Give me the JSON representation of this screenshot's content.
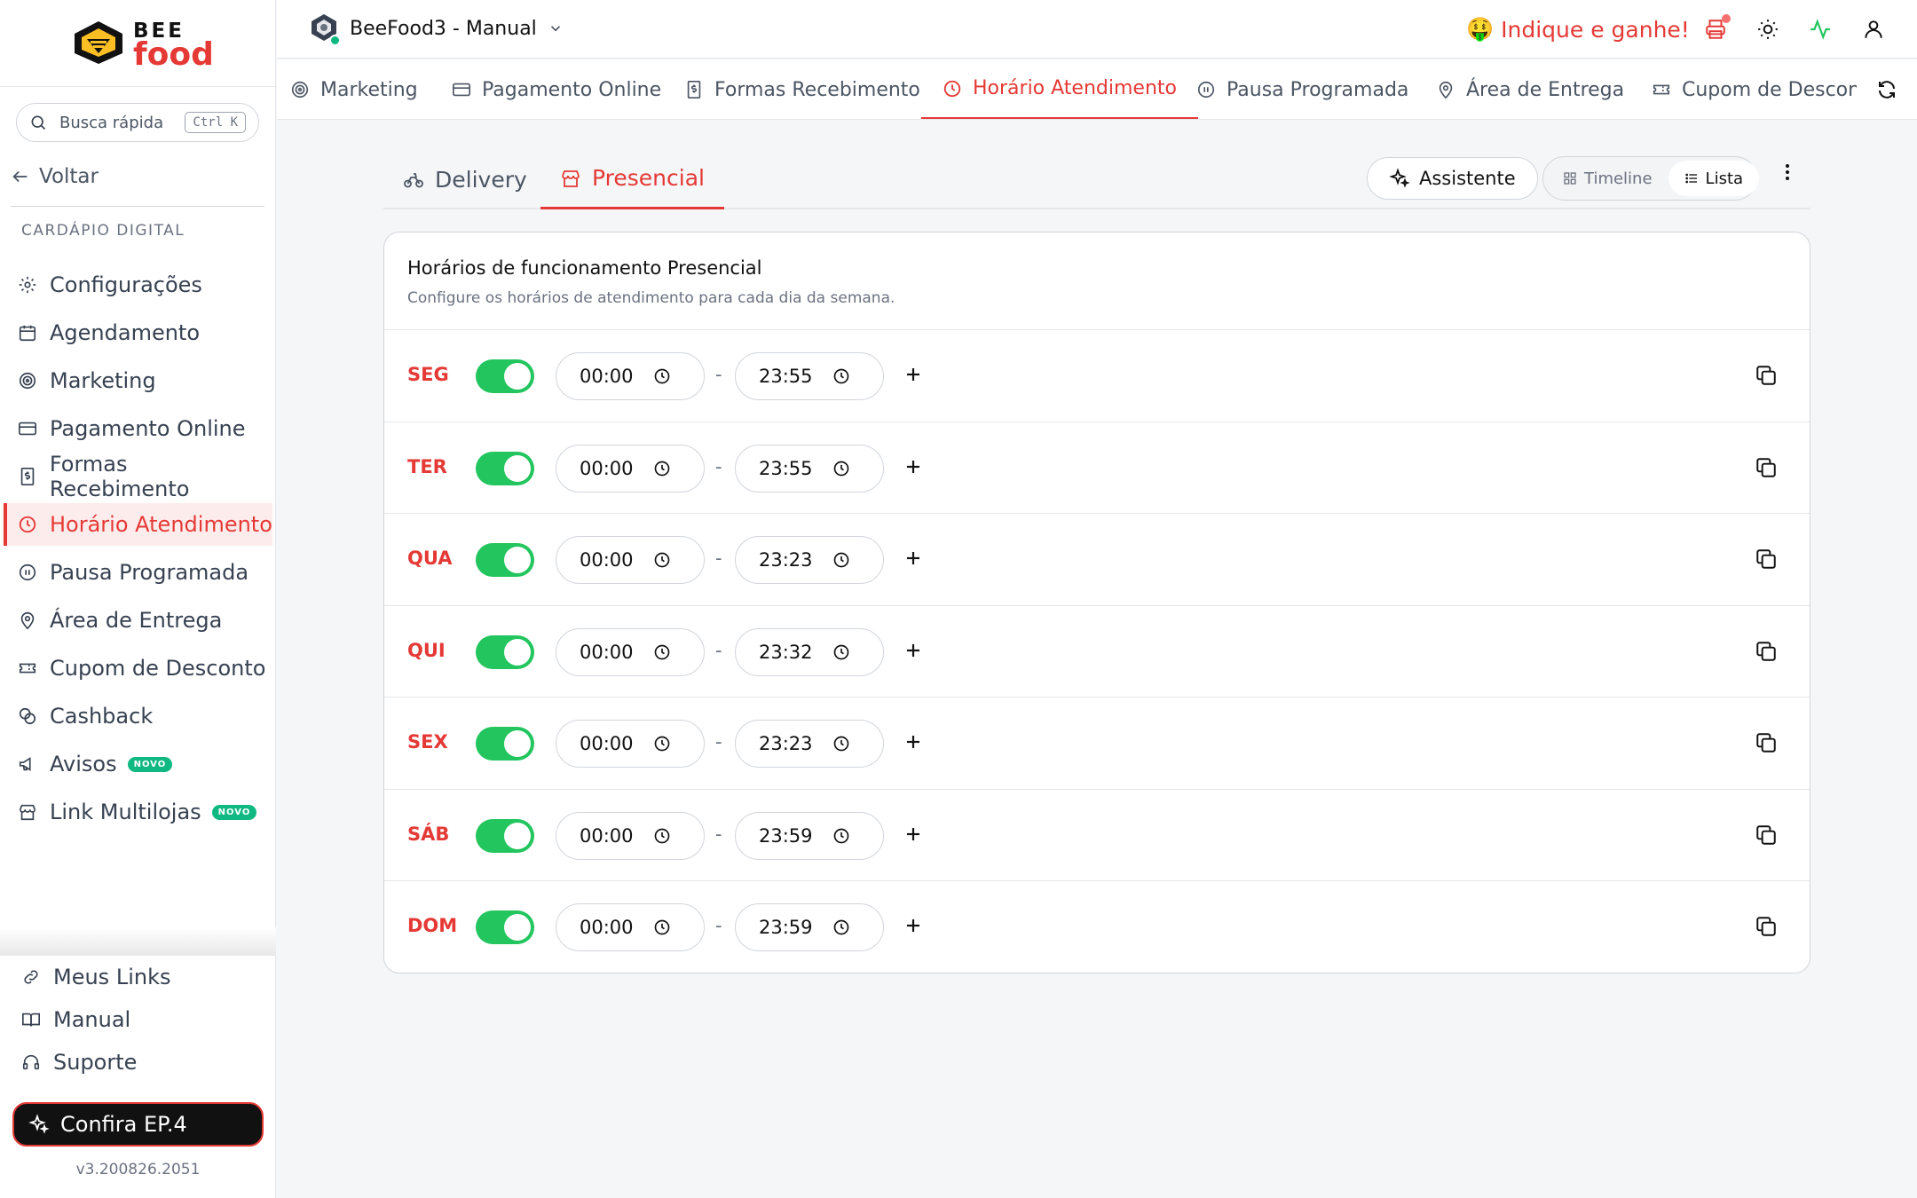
{
  "brand": {
    "word_top": "BEE",
    "word_bottom": "food"
  },
  "sidebar": {
    "search": {
      "label": "Busca rápida",
      "shortcut": "Ctrl K"
    },
    "back_label": "Voltar",
    "section_label": "CARDÁPIO DIGITAL",
    "items": [
      {
        "label": "Configurações",
        "icon": "gear-icon"
      },
      {
        "label": "Agendamento",
        "icon": "calendar-icon"
      },
      {
        "label": "Marketing",
        "icon": "target-icon"
      },
      {
        "label": "Pagamento Online",
        "icon": "credit-card-icon"
      },
      {
        "label": "Formas Recebimento",
        "icon": "receipt-icon"
      },
      {
        "label": "Horário Atendimento",
        "icon": "clock-icon",
        "active": true
      },
      {
        "label": "Pausa Programada",
        "icon": "pause-icon"
      },
      {
        "label": "Área de Entrega",
        "icon": "map-pin-icon"
      },
      {
        "label": "Cupom de Desconto",
        "icon": "ticket-icon"
      },
      {
        "label": "Cashback",
        "icon": "coins-icon"
      },
      {
        "label": "Avisos",
        "icon": "megaphone-icon",
        "badge": "NOVO"
      },
      {
        "label": "Link Multilojas",
        "icon": "store-icon",
        "badge": "NOVO"
      }
    ],
    "bottom_links": [
      {
        "label": "Meus Links",
        "icon": "link-icon"
      },
      {
        "label": "Manual",
        "icon": "book-icon"
      },
      {
        "label": "Suporte",
        "icon": "headset-icon"
      }
    ],
    "cta_label": "Confira EP.4",
    "version": "v3.200826.2051"
  },
  "header": {
    "store_name": "BeeFood3 - Manual",
    "referral_label": "Indique e ganhe!",
    "referral_emoji": "🤑",
    "icons": [
      "printer-icon",
      "sun-icon",
      "activity-icon",
      "user-icon"
    ]
  },
  "top_tabs": [
    {
      "label": "Marketing",
      "icon": "target-icon"
    },
    {
      "label": "Pagamento Online",
      "icon": "credit-card-icon"
    },
    {
      "label": "Formas Recebimento",
      "icon": "receipt-icon"
    },
    {
      "label": "Horário Atendimento",
      "icon": "clock-icon",
      "active": true
    },
    {
      "label": "Pausa Programada",
      "icon": "pause-icon"
    },
    {
      "label": "Área de Entrega",
      "icon": "map-pin-icon"
    },
    {
      "label": "Cupom de Desconto",
      "icon": "ticket-icon"
    }
  ],
  "sub_tabs": [
    {
      "label": "Delivery",
      "icon": "bike-icon"
    },
    {
      "label": "Presencial",
      "icon": "store-icon",
      "active": true
    }
  ],
  "actions": {
    "assistant_label": "Assistente",
    "view_timeline": "Timeline",
    "view_list": "Lista",
    "view_selected": "Lista"
  },
  "schedule": {
    "title": "Horários de funcionamento Presencial",
    "subtitle": "Configure os horários de atendimento para cada dia da semana.",
    "separator": "-",
    "days": [
      {
        "day": "SEG",
        "enabled": true,
        "start": "00:00",
        "end": "23:55"
      },
      {
        "day": "TER",
        "enabled": true,
        "start": "00:00",
        "end": "23:55"
      },
      {
        "day": "QUA",
        "enabled": true,
        "start": "00:00",
        "end": "23:23"
      },
      {
        "day": "QUI",
        "enabled": true,
        "start": "00:00",
        "end": "23:32"
      },
      {
        "day": "SEX",
        "enabled": true,
        "start": "00:00",
        "end": "23:23"
      },
      {
        "day": "SÁB",
        "enabled": true,
        "start": "00:00",
        "end": "23:59"
      },
      {
        "day": "DOM",
        "enabled": true,
        "start": "00:00",
        "end": "23:59"
      }
    ]
  },
  "colors": {
    "accent": "#e53935",
    "toggle_on": "#22c55e",
    "badge": "#10b981"
  }
}
